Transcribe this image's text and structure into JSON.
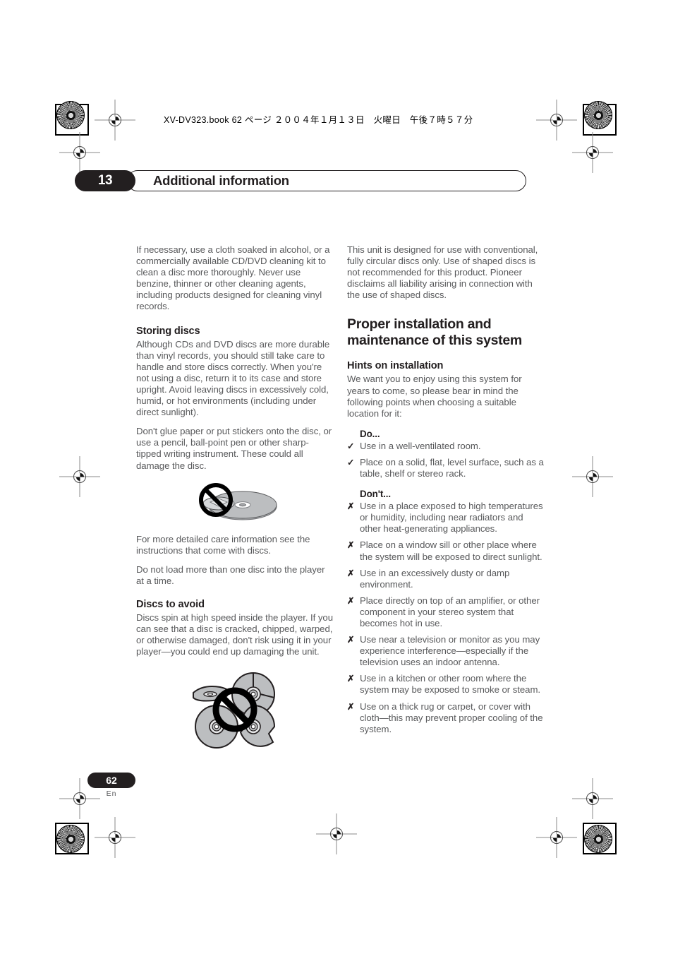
{
  "header": {
    "book_line": "XV-DV323.book  62 ページ  ２００４年１月１３日　火曜日　午後７時５７分"
  },
  "chapter": {
    "number": "13",
    "title": "Additional information"
  },
  "left_column": {
    "intro_paragraph": "If necessary, use a cloth soaked in alcohol, or a commercially available CD/DVD cleaning kit to clean a disc more thoroughly. Never use benzine, thinner or other cleaning agents, including products designed for cleaning vinyl records.",
    "storing_heading": "Storing discs",
    "storing_p1": "Although CDs and DVD discs are more durable than vinyl records, you should still take care to handle and store discs correctly. When you're not using a disc, return it to its case and store upright. Avoid leaving discs in excessively cold, humid, or hot environments (including under direct sunlight).",
    "storing_p2": "Don't glue paper or put stickers onto the disc, or use a pencil, ball-point pen or other sharp-tipped writing instrument. These could all damage the disc.",
    "figure_no_sticker_caption": "no-sticker-on-disc-illustration",
    "storing_p3": "For more detailed care information see the instructions that come with discs.",
    "storing_p4": "Do not load more than one disc into the player at a time.",
    "avoid_heading": "Discs to avoid",
    "avoid_p1": "Discs spin at high speed inside the player. If you can see that a disc is cracked, chipped, warped, or otherwise damaged, don't risk using it in your player—you could end up damaging the unit.",
    "figure_damaged_caption": "damaged-discs-illustration"
  },
  "right_column": {
    "intro_paragraph": "This unit is designed for use with conventional, fully circular discs only. Use of shaped discs is not recommended for this product. Pioneer disclaims all liability arising in connection with the use of shaped discs.",
    "major_heading": "Proper installation and maintenance of this system",
    "hints_heading": "Hints on installation",
    "hints_paragraph": "We want you to enjoy using this system for years to come, so please bear in mind the following points when choosing a suitable location for it:",
    "do_label": "Do...",
    "do_mark": "✓",
    "do_items": [
      "Use in a well-ventilated room.",
      "Place on a solid, flat, level surface, such as a table, shelf or stereo rack."
    ],
    "dont_label": "Don't...",
    "dont_mark": "✗",
    "dont_items": [
      "Use in a place exposed to high temperatures or humidity, including near radiators and other heat-generating appliances.",
      "Place on a window sill or other place where the system will be exposed to direct sunlight.",
      "Use in an excessively dusty or damp environment.",
      "Place directly on top of an amplifier, or other component in your stereo system that becomes hot in use.",
      "Use near a television or monitor as you may experience interference—especially if the television uses an indoor antenna.",
      "Use in a kitchen or other room where the system may be exposed to smoke or steam.",
      "Use on a thick rug or carpet, or cover with cloth—this may prevent proper cooling of the system."
    ]
  },
  "footer": {
    "page_number": "62",
    "language_code": "En"
  },
  "colors": {
    "ink_black": "#231f20",
    "body_gray": "#58595b",
    "disc_gray": "#a7a9ac"
  }
}
